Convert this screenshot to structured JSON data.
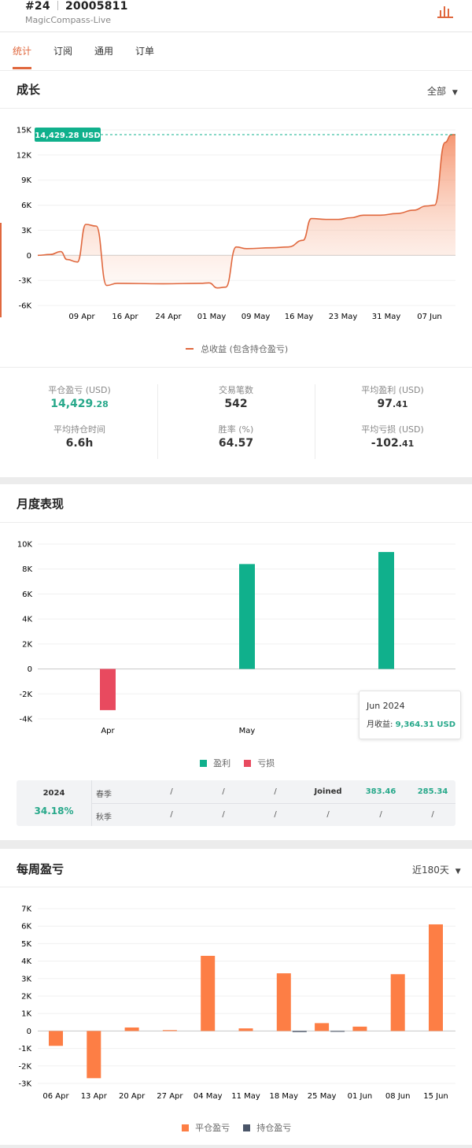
{
  "account": {
    "number": "#24",
    "id": "20005811",
    "server": "MagicCompass-Live",
    "chart_icon": "bar-chart-icon"
  },
  "tabs": [
    "统计",
    "订阅",
    "通用",
    "订单"
  ],
  "growth": {
    "title": "成长",
    "filter": "全部",
    "badge": "14,429.28 USD",
    "legend": "总收益 (包含持仓盈亏)",
    "y_ticks": [
      "15K",
      "12K",
      "9K",
      "6K",
      "3K",
      "0",
      "-3K",
      "-6K"
    ],
    "x_ticks": [
      "09 Apr",
      "16 Apr",
      "24 Apr",
      "01 May",
      "09 May",
      "16 May",
      "23 May",
      "31 May",
      "07 Jun"
    ]
  },
  "stats": {
    "closed_pnl": {
      "label": "平仓盈亏 (USD)",
      "int": "14,429",
      "dec": ".28"
    },
    "trades": {
      "label": "交易笔数",
      "value": "542"
    },
    "avg_profit": {
      "label": "平均盈利 (USD)",
      "int": "97",
      "dec": ".41"
    },
    "avg_hold": {
      "label": "平均持仓时间",
      "value": "6.6h"
    },
    "win_rate": {
      "label": "胜率 (%)",
      "value": "64.57"
    },
    "avg_loss": {
      "label": "平均亏损 (USD)",
      "int": "-102",
      "dec": ".41"
    }
  },
  "monthly": {
    "title": "月度表现",
    "y_ticks": [
      "10K",
      "8K",
      "6K",
      "4K",
      "2K",
      "0",
      "-2K",
      "-4K"
    ],
    "legend_profit": "盈利",
    "legend_loss": "亏损",
    "tooltip": {
      "title": "Jun 2024",
      "label": "月收益:",
      "value": "9,364.31 USD"
    },
    "table": {
      "year": "2024",
      "year_pct": "34.18%",
      "row1_label": "春季",
      "row1": [
        "/",
        "/",
        "/",
        "Joined",
        "383.46",
        "285.34"
      ],
      "row2_label": "秋季",
      "row2": [
        "/",
        "/",
        "/",
        "/",
        "/",
        "/"
      ]
    }
  },
  "weekly": {
    "title": "每周盈亏",
    "filter": "近180天",
    "y_ticks": [
      "7K",
      "6K",
      "5K",
      "4K",
      "3K",
      "2K",
      "1K",
      "0",
      "-1K",
      "-2K",
      "-3K"
    ],
    "legend_closed": "平仓盈亏",
    "legend_open": "持仓盈亏"
  },
  "colors": {
    "accent": "#e0683e",
    "profit": "#10b08c",
    "loss": "#e84a5f",
    "bar_orange": "#fd7e45",
    "bar_dark": "#4a5568"
  },
  "chart_data": [
    {
      "type": "area",
      "title": "成长",
      "ylim": [
        -6000,
        15000
      ],
      "x": [
        "09 Apr",
        "16 Apr",
        "24 Apr",
        "01 May",
        "09 May",
        "16 May",
        "23 May",
        "31 May",
        "07 Jun"
      ],
      "series": [
        {
          "name": "总收益 (包含持仓盈亏)",
          "points": [
            [
              0,
              0
            ],
            [
              0.03,
              100
            ],
            [
              0.055,
              450
            ],
            [
              0.07,
              -500
            ],
            [
              0.095,
              -800
            ],
            [
              0.115,
              3700
            ],
            [
              0.14,
              3500
            ],
            [
              0.165,
              -3600
            ],
            [
              0.19,
              -3350
            ],
            [
              0.3,
              -3400
            ],
            [
              0.39,
              -3350
            ],
            [
              0.41,
              -3300
            ],
            [
              0.43,
              -3900
            ],
            [
              0.45,
              -3800
            ],
            [
              0.475,
              1000
            ],
            [
              0.5,
              800
            ],
            [
              0.56,
              900
            ],
            [
              0.6,
              1000
            ],
            [
              0.635,
              1800
            ],
            [
              0.655,
              4400
            ],
            [
              0.69,
              4300
            ],
            [
              0.72,
              4300
            ],
            [
              0.75,
              4500
            ],
            [
              0.78,
              4800
            ],
            [
              0.82,
              4800
            ],
            [
              0.86,
              5000
            ],
            [
              0.9,
              5400
            ],
            [
              0.93,
              5900
            ],
            [
              0.95,
              6000
            ],
            [
              0.975,
              13500
            ],
            [
              0.99,
              14429
            ],
            [
              1,
              14429
            ]
          ]
        }
      ],
      "end_value": 14429.28
    },
    {
      "type": "bar",
      "title": "月度表现",
      "categories": [
        "Apr",
        "May",
        "Jun"
      ],
      "values": [
        -3300,
        8400,
        9364.31
      ],
      "ylim": [
        -4000,
        10000
      ]
    },
    {
      "type": "bar",
      "title": "每周盈亏",
      "categories": [
        "06 Apr",
        "13 Apr",
        "20 Apr",
        "27 Apr",
        "04 May",
        "11 May",
        "18 May",
        "25 May",
        "01 Jun",
        "08 Jun",
        "15 Jun"
      ],
      "series": [
        {
          "name": "平仓盈亏",
          "values": [
            -850,
            -2700,
            200,
            50,
            4300,
            150,
            3300,
            450,
            250,
            3250,
            6100
          ]
        },
        {
          "name": "持仓盈亏",
          "values": [
            0,
            0,
            0,
            0,
            0,
            0,
            -60,
            -30,
            0,
            0,
            0
          ]
        }
      ],
      "ylim": [
        -3000,
        7000
      ]
    }
  ]
}
